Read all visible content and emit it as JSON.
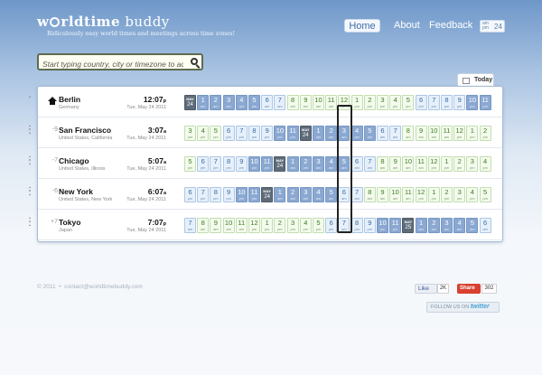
{
  "header": {
    "logo_pre": "w",
    "logo_rest": "rldtime",
    "logo_suffix": " buddy",
    "tagline": "Ridiculously easy world times and meetings across time zones!",
    "nav": {
      "home": "Home",
      "about": "About",
      "feedback": "Feedback"
    },
    "hour_toggle": {
      "ampm_top": "am",
      "ampm_bottom": "pm",
      "h24": "24"
    }
  },
  "search": {
    "placeholder": "Start typing country, city or timezone to add it..."
  },
  "today_label": "Today",
  "rows": [
    {
      "city": "Berlin",
      "country": "Germany",
      "offset": "",
      "home": true,
      "time": "12:07",
      "ampm": "p",
      "date": "Tue, May 24 2011",
      "cells": [
        {
          "n": "MAY",
          "s": "24",
          "c": "date"
        },
        {
          "n": "1",
          "s": "am",
          "c": "dark"
        },
        {
          "n": "2",
          "s": "am",
          "c": "dark"
        },
        {
          "n": "3",
          "s": "am",
          "c": "dark"
        },
        {
          "n": "4",
          "s": "am",
          "c": "dark"
        },
        {
          "n": "5",
          "s": "am",
          "c": "dark"
        },
        {
          "n": "6",
          "s": "am",
          "c": "late"
        },
        {
          "n": "7",
          "s": "am",
          "c": "late"
        },
        {
          "n": "8",
          "s": "am",
          "c": "day"
        },
        {
          "n": "9",
          "s": "am",
          "c": "day"
        },
        {
          "n": "10",
          "s": "am",
          "c": "day"
        },
        {
          "n": "11",
          "s": "am",
          "c": "day"
        },
        {
          "n": "12",
          "s": "pm",
          "c": "day"
        },
        {
          "n": "1",
          "s": "pm",
          "c": "day"
        },
        {
          "n": "2",
          "s": "pm",
          "c": "day"
        },
        {
          "n": "3",
          "s": "pm",
          "c": "day"
        },
        {
          "n": "4",
          "s": "pm",
          "c": "day"
        },
        {
          "n": "5",
          "s": "pm",
          "c": "day"
        },
        {
          "n": "6",
          "s": "pm",
          "c": "late"
        },
        {
          "n": "7",
          "s": "pm",
          "c": "late"
        },
        {
          "n": "8",
          "s": "pm",
          "c": "late"
        },
        {
          "n": "9",
          "s": "pm",
          "c": "late"
        },
        {
          "n": "10",
          "s": "pm",
          "c": "dark"
        },
        {
          "n": "11",
          "s": "pm",
          "c": "dark"
        }
      ]
    },
    {
      "city": "San Francisco",
      "country": "United States, California",
      "offset": "-9",
      "home": false,
      "time": "3:07",
      "ampm": "a",
      "date": "Tue, May 24 2011",
      "cells": [
        {
          "n": "3",
          "s": "pm",
          "c": "day"
        },
        {
          "n": "4",
          "s": "pm",
          "c": "day"
        },
        {
          "n": "5",
          "s": "pm",
          "c": "day"
        },
        {
          "n": "6",
          "s": "pm",
          "c": "late"
        },
        {
          "n": "7",
          "s": "pm",
          "c": "late"
        },
        {
          "n": "8",
          "s": "pm",
          "c": "late"
        },
        {
          "n": "9",
          "s": "pm",
          "c": "late"
        },
        {
          "n": "10",
          "s": "pm",
          "c": "dark"
        },
        {
          "n": "11",
          "s": "pm",
          "c": "dark"
        },
        {
          "n": "MAY",
          "s": "24",
          "c": "date"
        },
        {
          "n": "1",
          "s": "am",
          "c": "dark"
        },
        {
          "n": "2",
          "s": "am",
          "c": "dark"
        },
        {
          "n": "3",
          "s": "am",
          "c": "dark"
        },
        {
          "n": "4",
          "s": "am",
          "c": "dark"
        },
        {
          "n": "5",
          "s": "am",
          "c": "dark"
        },
        {
          "n": "6",
          "s": "am",
          "c": "late"
        },
        {
          "n": "7",
          "s": "am",
          "c": "late"
        },
        {
          "n": "8",
          "s": "am",
          "c": "day"
        },
        {
          "n": "9",
          "s": "am",
          "c": "day"
        },
        {
          "n": "10",
          "s": "am",
          "c": "day"
        },
        {
          "n": "11",
          "s": "am",
          "c": "day"
        },
        {
          "n": "12",
          "s": "pm",
          "c": "day"
        },
        {
          "n": "1",
          "s": "pm",
          "c": "day"
        },
        {
          "n": "2",
          "s": "pm",
          "c": "day"
        }
      ]
    },
    {
      "city": "Chicago",
      "country": "United States, Illinois",
      "offset": "-7",
      "home": false,
      "time": "5:07",
      "ampm": "a",
      "date": "Tue, May 24 2011",
      "cells": [
        {
          "n": "5",
          "s": "pm",
          "c": "day"
        },
        {
          "n": "6",
          "s": "pm",
          "c": "late"
        },
        {
          "n": "7",
          "s": "pm",
          "c": "late"
        },
        {
          "n": "8",
          "s": "pm",
          "c": "late"
        },
        {
          "n": "9",
          "s": "pm",
          "c": "late"
        },
        {
          "n": "10",
          "s": "pm",
          "c": "dark"
        },
        {
          "n": "11",
          "s": "pm",
          "c": "dark"
        },
        {
          "n": "MAY",
          "s": "24",
          "c": "date"
        },
        {
          "n": "1",
          "s": "am",
          "c": "dark"
        },
        {
          "n": "2",
          "s": "am",
          "c": "dark"
        },
        {
          "n": "3",
          "s": "am",
          "c": "dark"
        },
        {
          "n": "4",
          "s": "am",
          "c": "dark"
        },
        {
          "n": "5",
          "s": "am",
          "c": "dark"
        },
        {
          "n": "6",
          "s": "am",
          "c": "late"
        },
        {
          "n": "7",
          "s": "am",
          "c": "late"
        },
        {
          "n": "8",
          "s": "am",
          "c": "day"
        },
        {
          "n": "9",
          "s": "am",
          "c": "day"
        },
        {
          "n": "10",
          "s": "am",
          "c": "day"
        },
        {
          "n": "11",
          "s": "am",
          "c": "day"
        },
        {
          "n": "12",
          "s": "pm",
          "c": "day"
        },
        {
          "n": "1",
          "s": "pm",
          "c": "day"
        },
        {
          "n": "2",
          "s": "pm",
          "c": "day"
        },
        {
          "n": "3",
          "s": "pm",
          "c": "day"
        },
        {
          "n": "4",
          "s": "pm",
          "c": "day"
        }
      ]
    },
    {
      "city": "New York",
      "country": "United States, New York",
      "offset": "-6",
      "home": false,
      "time": "6:07",
      "ampm": "a",
      "date": "Tue, May 24 2011",
      "cells": [
        {
          "n": "6",
          "s": "pm",
          "c": "late"
        },
        {
          "n": "7",
          "s": "pm",
          "c": "late"
        },
        {
          "n": "8",
          "s": "pm",
          "c": "late"
        },
        {
          "n": "9",
          "s": "pm",
          "c": "late"
        },
        {
          "n": "10",
          "s": "pm",
          "c": "dark"
        },
        {
          "n": "11",
          "s": "pm",
          "c": "dark"
        },
        {
          "n": "MAY",
          "s": "24",
          "c": "date"
        },
        {
          "n": "1",
          "s": "am",
          "c": "dark"
        },
        {
          "n": "2",
          "s": "am",
          "c": "dark"
        },
        {
          "n": "3",
          "s": "am",
          "c": "dark"
        },
        {
          "n": "4",
          "s": "am",
          "c": "dark"
        },
        {
          "n": "5",
          "s": "am",
          "c": "dark"
        },
        {
          "n": "6",
          "s": "am",
          "c": "late"
        },
        {
          "n": "7",
          "s": "am",
          "c": "late"
        },
        {
          "n": "8",
          "s": "am",
          "c": "day"
        },
        {
          "n": "9",
          "s": "am",
          "c": "day"
        },
        {
          "n": "10",
          "s": "am",
          "c": "day"
        },
        {
          "n": "11",
          "s": "am",
          "c": "day"
        },
        {
          "n": "12",
          "s": "pm",
          "c": "day"
        },
        {
          "n": "1",
          "s": "pm",
          "c": "day"
        },
        {
          "n": "2",
          "s": "pm",
          "c": "day"
        },
        {
          "n": "3",
          "s": "pm",
          "c": "day"
        },
        {
          "n": "4",
          "s": "pm",
          "c": "day"
        },
        {
          "n": "5",
          "s": "pm",
          "c": "day"
        }
      ]
    },
    {
      "city": "Tokyo",
      "country": "Japan",
      "offset": "+7",
      "home": false,
      "time": "7:07",
      "ampm": "p",
      "date": "Tue, May 24 2011",
      "cells": [
        {
          "n": "7",
          "s": "am",
          "c": "late"
        },
        {
          "n": "8",
          "s": "am",
          "c": "day"
        },
        {
          "n": "9",
          "s": "am",
          "c": "day"
        },
        {
          "n": "10",
          "s": "am",
          "c": "day"
        },
        {
          "n": "11",
          "s": "am",
          "c": "day"
        },
        {
          "n": "12",
          "s": "pm",
          "c": "day"
        },
        {
          "n": "1",
          "s": "pm",
          "c": "day"
        },
        {
          "n": "2",
          "s": "pm",
          "c": "day"
        },
        {
          "n": "3",
          "s": "pm",
          "c": "day"
        },
        {
          "n": "4",
          "s": "pm",
          "c": "day"
        },
        {
          "n": "5",
          "s": "pm",
          "c": "day"
        },
        {
          "n": "6",
          "s": "pm",
          "c": "late"
        },
        {
          "n": "7",
          "s": "pm",
          "c": "late"
        },
        {
          "n": "8",
          "s": "pm",
          "c": "late"
        },
        {
          "n": "9",
          "s": "pm",
          "c": "late"
        },
        {
          "n": "10",
          "s": "pm",
          "c": "dark"
        },
        {
          "n": "11",
          "s": "pm",
          "c": "dark"
        },
        {
          "n": "MAY",
          "s": "25",
          "c": "date"
        },
        {
          "n": "1",
          "s": "am",
          "c": "dark"
        },
        {
          "n": "2",
          "s": "am",
          "c": "dark"
        },
        {
          "n": "3",
          "s": "am",
          "c": "dark"
        },
        {
          "n": "4",
          "s": "am",
          "c": "dark"
        },
        {
          "n": "5",
          "s": "am",
          "c": "dark"
        },
        {
          "n": "6",
          "s": "am",
          "c": "late"
        }
      ]
    }
  ],
  "footer": {
    "copyright": "© 2011",
    "bullet": "•",
    "contact": "contact@worldtimebuddy.com",
    "fb_like": "Like",
    "fb_count": "2K",
    "share": "Share",
    "share_count": "302",
    "follow_text": "FOLLOW US ON",
    "follow_brand": "twitter"
  }
}
